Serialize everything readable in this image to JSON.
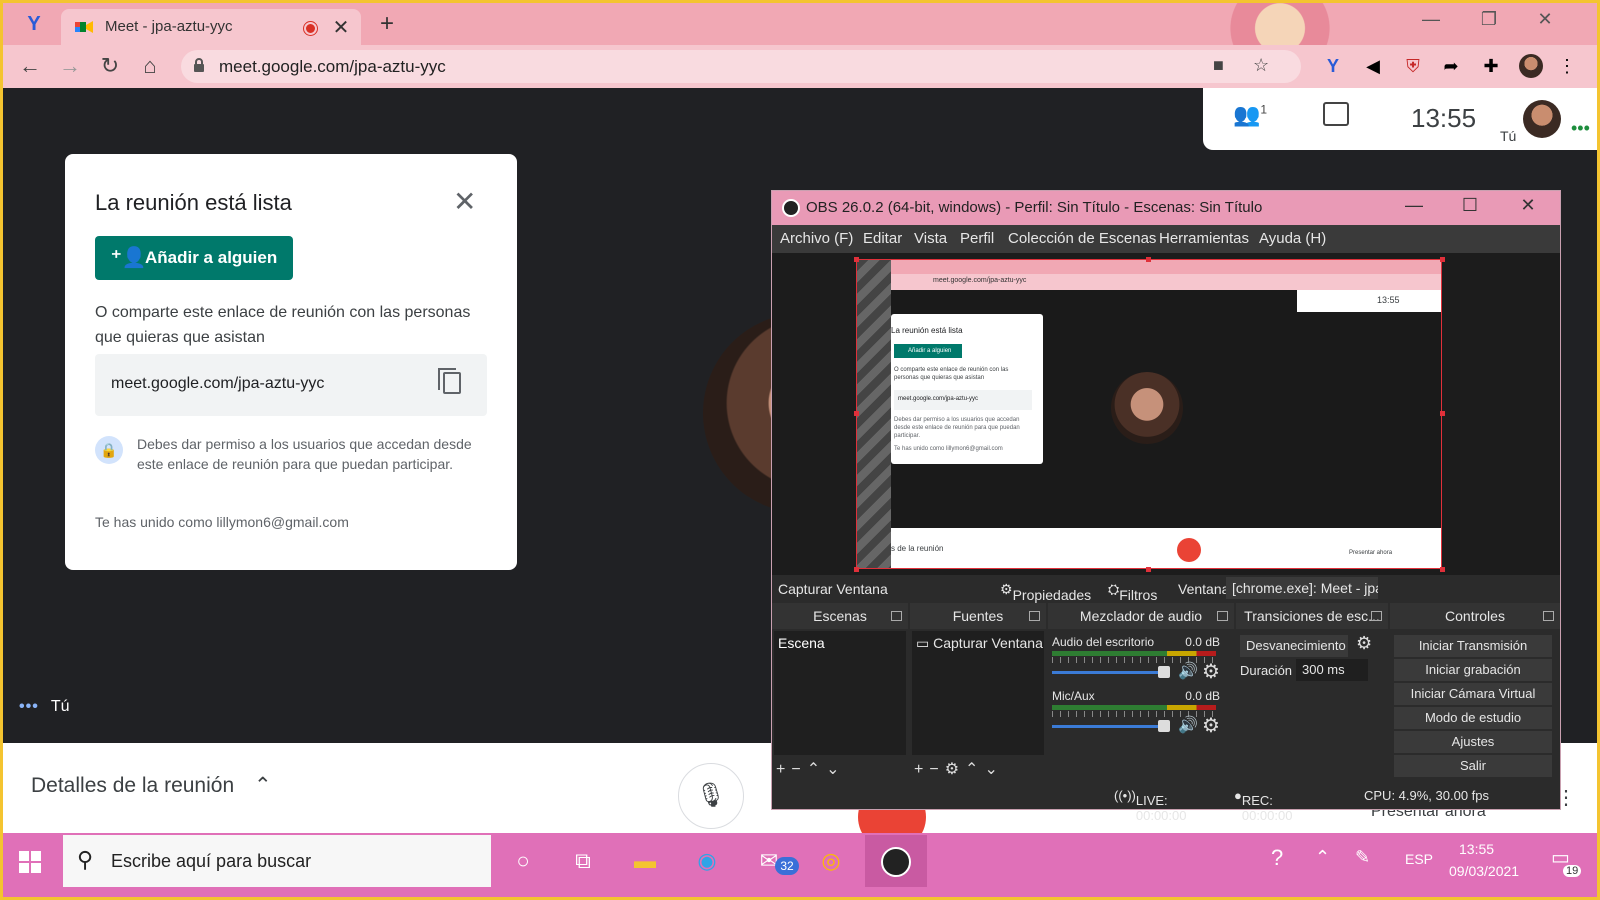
{
  "browser": {
    "tab_title": "Meet - jpa-aztu-yyc",
    "tab_close": "✕",
    "new_tab": "+",
    "url": "meet.google.com/jpa-aztu-yyc",
    "window_min": "—",
    "window_max": "❐",
    "window_close": "✕"
  },
  "meet": {
    "participants_count": "1",
    "clock": "13:55",
    "self_short": "Tú",
    "self_label": "Tú",
    "card": {
      "title": "La reunión está lista",
      "add_button": "Añadir a alguien",
      "share_text": "O comparte este enlace de reunión con las personas que quieras que asistan",
      "link": "meet.google.com/jpa-aztu-yyc",
      "permission_text": "Debes dar permiso a los usuarios que accedan desde este enlace de reunión para que puedan participar.",
      "joined_as": "Te has unido como lillymon6@gmail.com"
    },
    "bottom": {
      "details": "Detalles de la reunión",
      "present": "Presentar ahora"
    }
  },
  "obs": {
    "title": "OBS 26.0.2 (64-bit, windows) - Perfil: Sin Título - Escenas: Sin Título",
    "menu": [
      "Archivo (F)",
      "Editar",
      "Vista",
      "Perfil",
      "Colección de Escenas",
      "Herramientas",
      "Ayuda (H)"
    ],
    "preview": {
      "url": "meet.google.com/jpa-aztu-yyc",
      "clock": "13:55",
      "card_title": "La reunión está lista",
      "add_button": "Añadir a alguien",
      "share_text": "O comparte este enlace de reunión con las personas que quieras que asistan",
      "link": "meet.google.com/jpa-aztu-yyc",
      "permission_text": "Debes dar permiso a los usuarios que accedan desde este enlace de reunión para que puedan participar.",
      "joined_as": "Te has unido como lillymon6@gmail.com",
      "details": "s de la reunión",
      "present": "Presentar ahora"
    },
    "source_bar": {
      "source_name": "Capturar Ventana",
      "properties": "Propiedades",
      "filters": "Filtros",
      "window_label": "Ventana",
      "window_value": "[chrome.exe]: Meet - jpa"
    },
    "docks": {
      "scenes": {
        "header": "Escenas",
        "items": [
          "Escena"
        ]
      },
      "sources": {
        "header": "Fuentes",
        "items": [
          "Capturar Ventana"
        ]
      },
      "mixer": {
        "header": "Mezclador de audio",
        "channels": [
          {
            "name": "Audio del escritorio",
            "db": "0.0 dB"
          },
          {
            "name": "Mic/Aux",
            "db": "0.0 dB"
          }
        ]
      },
      "transitions": {
        "header": "Transiciones de esc...",
        "selected": "Desvanecimiento",
        "duration_label": "Duración",
        "duration_value": "300 ms"
      },
      "controls": {
        "header": "Controles",
        "buttons": [
          "Iniciar Transmisión",
          "Iniciar grabación",
          "Iniciar Cámara Virtual",
          "Modo de estudio",
          "Ajustes",
          "Salir"
        ]
      }
    },
    "status": {
      "live": "LIVE: 00:00:00",
      "rec": "REC: 00:00:00",
      "cpu": "CPU: 4.9%, 30.00 fps"
    }
  },
  "taskbar": {
    "search_placeholder": "Escribe aquí para buscar",
    "mail_badge": "32",
    "language": "ESP",
    "time": "13:55",
    "date": "09/03/2021",
    "notification_count": "19"
  }
}
